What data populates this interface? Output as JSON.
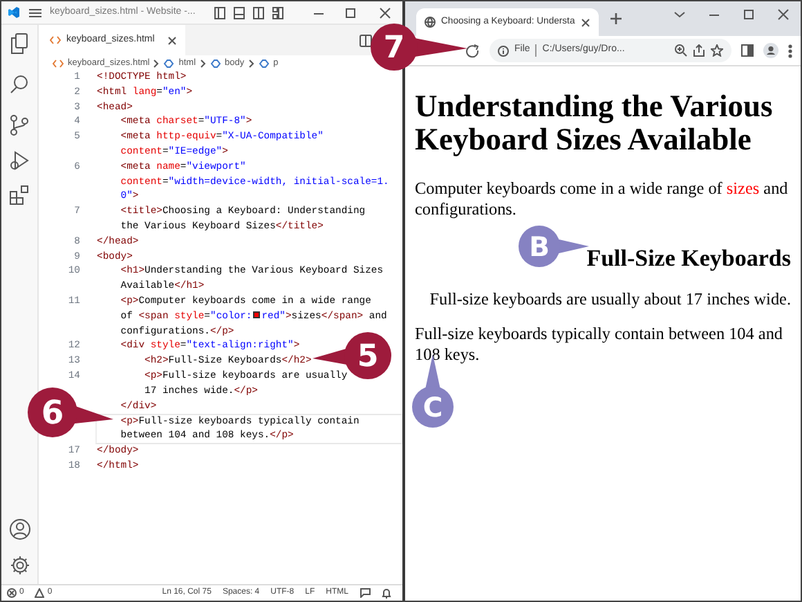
{
  "editor": {
    "title": "keyboard_sizes.html - Website -...",
    "tab": {
      "label": "keyboard_sizes.html",
      "selected": true
    },
    "breadcrumbs": [
      "keyboard_sizes.html",
      "html",
      "body",
      "p"
    ],
    "lines": [
      {
        "number": "1",
        "current": false,
        "tokens": [
          {
            "kind": "tag",
            "text": "<!DOCTYPE html>"
          }
        ]
      },
      {
        "number": "2",
        "current": false,
        "tokens": [
          {
            "kind": "tag",
            "text": "<html "
          },
          {
            "kind": "attr",
            "text": "lang"
          },
          {
            "kind": "text",
            "text": "="
          },
          {
            "kind": "string",
            "text": "\"en\""
          },
          {
            "kind": "tag",
            "text": ">"
          }
        ]
      },
      {
        "number": "3",
        "current": false,
        "tokens": [
          {
            "kind": "tag",
            "text": "<head>"
          }
        ]
      },
      {
        "number": "4",
        "current": false,
        "tokens": [
          {
            "kind": "tag",
            "text": "    <meta "
          },
          {
            "kind": "attr",
            "text": "charset"
          },
          {
            "kind": "text",
            "text": "="
          },
          {
            "kind": "string",
            "text": "\"UTF-8\""
          },
          {
            "kind": "tag",
            "text": ">"
          }
        ]
      },
      {
        "number": "5",
        "current": false,
        "tokens": [
          {
            "kind": "tag",
            "text": "    <meta "
          },
          {
            "kind": "attr",
            "text": "http-equiv"
          },
          {
            "kind": "text",
            "text": "="
          },
          {
            "kind": "string",
            "text": "\"X-UA-Compatible\""
          }
        ]
      },
      {
        "current": false,
        "tokens": [
          {
            "kind": "attr",
            "text": "    content"
          },
          {
            "kind": "text",
            "text": "="
          },
          {
            "kind": "string",
            "text": "\"IE=edge\""
          },
          {
            "kind": "tag",
            "text": ">"
          }
        ]
      },
      {
        "number": "6",
        "current": false,
        "tokens": [
          {
            "kind": "tag",
            "text": "    <meta "
          },
          {
            "kind": "attr",
            "text": "name"
          },
          {
            "kind": "text",
            "text": "="
          },
          {
            "kind": "string",
            "text": "\"viewport\""
          }
        ]
      },
      {
        "current": false,
        "tokens": [
          {
            "kind": "attr",
            "text": "    content"
          },
          {
            "kind": "text",
            "text": "="
          },
          {
            "kind": "string",
            "text": "\"width=device-width, initial-scale=1."
          }
        ]
      },
      {
        "current": false,
        "tokens": [
          {
            "kind": "string",
            "text": "    0\""
          },
          {
            "kind": "tag",
            "text": ">"
          }
        ]
      },
      {
        "number": "7",
        "current": false,
        "tokens": [
          {
            "kind": "tag",
            "text": "    <title>"
          },
          {
            "kind": "text",
            "text": "Choosing a Keyboard: Understanding"
          }
        ]
      },
      {
        "current": false,
        "tokens": [
          {
            "kind": "text",
            "text": "    the Various Keyboard Sizes"
          },
          {
            "kind": "tag",
            "text": "</title>"
          }
        ]
      },
      {
        "number": "8",
        "current": false,
        "tokens": [
          {
            "kind": "tag",
            "text": "</head>"
          }
        ]
      },
      {
        "number": "9",
        "current": false,
        "tokens": [
          {
            "kind": "tag",
            "text": "<body>"
          }
        ]
      },
      {
        "number": "10",
        "current": false,
        "tokens": [
          {
            "kind": "tag",
            "text": "    <h1>"
          },
          {
            "kind": "text",
            "text": "Understanding the Various Keyboard Sizes"
          }
        ]
      },
      {
        "current": false,
        "tokens": [
          {
            "kind": "text",
            "text": "    Available"
          },
          {
            "kind": "tag",
            "text": "</h1>"
          }
        ]
      },
      {
        "number": "11",
        "current": false,
        "tokens": [
          {
            "kind": "tag",
            "text": "    <p>"
          },
          {
            "kind": "text",
            "text": "Computer keyboards come in a wide range"
          }
        ]
      },
      {
        "current": false,
        "tokens": [
          {
            "kind": "text",
            "text": "    of "
          },
          {
            "kind": "tag",
            "text": "<span "
          },
          {
            "kind": "attr",
            "text": "style"
          },
          {
            "kind": "text",
            "text": "="
          },
          {
            "kind": "string",
            "text": "\"color:"
          },
          {
            "kind": "swatch",
            "color": "#ff0000"
          },
          {
            "kind": "string",
            "text": "red\""
          },
          {
            "kind": "tag",
            "text": ">"
          },
          {
            "kind": "text",
            "text": "sizes"
          },
          {
            "kind": "tag",
            "text": "</span>"
          },
          {
            "kind": "text",
            "text": " and"
          }
        ]
      },
      {
        "current": false,
        "tokens": [
          {
            "kind": "text",
            "text": "    configurations."
          },
          {
            "kind": "tag",
            "text": "</p>"
          }
        ]
      },
      {
        "number": "12",
        "current": false,
        "tokens": [
          {
            "kind": "tag",
            "text": "    <div "
          },
          {
            "kind": "attr",
            "text": "style"
          },
          {
            "kind": "text",
            "text": "="
          },
          {
            "kind": "string",
            "text": "\"text-align:right\""
          },
          {
            "kind": "tag",
            "text": ">"
          }
        ]
      },
      {
        "number": "13",
        "current": false,
        "tokens": [
          {
            "kind": "tag",
            "text": "        <h2>"
          },
          {
            "kind": "text",
            "text": "Full-Size Keyboards"
          },
          {
            "kind": "tag",
            "text": "</h2>"
          }
        ]
      },
      {
        "number": "14",
        "current": false,
        "tokens": [
          {
            "kind": "tag",
            "text": "        <p>"
          },
          {
            "kind": "text",
            "text": "Full-size keyboards are usually"
          }
        ]
      },
      {
        "current": false,
        "tokens": [
          {
            "kind": "text",
            "text": "        17 inches wide."
          },
          {
            "kind": "tag",
            "text": "</p>"
          }
        ]
      },
      {
        "current": false,
        "tokens": [
          {
            "kind": "tag",
            "text": "    </div>"
          }
        ]
      },
      {
        "current": true,
        "tokens": [
          {
            "kind": "tag",
            "text": "    <p>"
          },
          {
            "kind": "text",
            "text": "Full-size keyboards typically contain"
          }
        ]
      },
      {
        "current": true,
        "tokens": [
          {
            "kind": "text",
            "text": "    between 104 and 108 keys."
          },
          {
            "kind": "tag",
            "text": "</p>"
          }
        ]
      },
      {
        "number": "17",
        "current": false,
        "tokens": [
          {
            "kind": "tag",
            "text": "</body>"
          }
        ]
      },
      {
        "number": "18",
        "current": false,
        "tokens": [
          {
            "kind": "tag",
            "text": "</html>"
          }
        ]
      }
    ],
    "status": {
      "errors": "0",
      "warnings": "0",
      "items": [
        "Ln 16, Col 75",
        "Spaces: 4",
        "UTF-8",
        "LF",
        "HTML"
      ]
    }
  },
  "browser": {
    "tab": {
      "title": "Choosing a Keyboard: Understa",
      "selected": true
    },
    "scheme": "File",
    "url": "C:/Users/guy/Dro...",
    "heading": "Understanding the Various Keyboard Sizes Available",
    "intro": [
      {
        "text": "Computer keyboards come in a wide range of ",
        "color": "#000000"
      },
      {
        "text": "sizes",
        "color": "#ff0000"
      },
      {
        "text": " and configurations.",
        "color": "#000000"
      }
    ],
    "subheading": "Full-Size Keyboards",
    "right_paragraph": "Full-size keyboards are usually about 17 inches wide.",
    "paragraph": "Full-size keyboards typically contain between 104 and 108 keys."
  },
  "callouts": [
    {
      "label": "7",
      "color": "#9e1b3c"
    },
    {
      "label": "5",
      "color": "#9e1b3c"
    },
    {
      "label": "6",
      "color": "#9e1b3c"
    },
    {
      "label": "B",
      "color": "#8682c2"
    },
    {
      "label": "C",
      "color": "#8682c2"
    }
  ]
}
